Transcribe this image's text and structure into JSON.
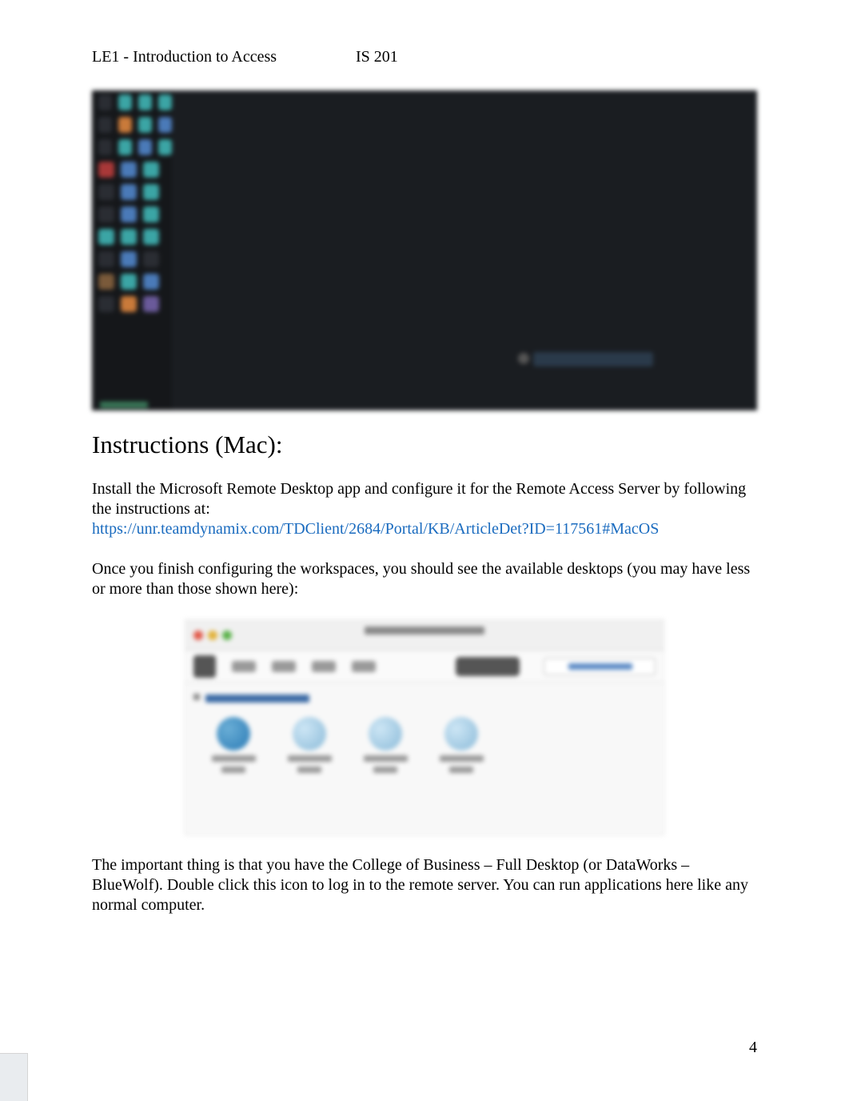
{
  "header": {
    "title_left": "LE1 - Introduction to Access",
    "title_right": "IS 201"
  },
  "section_heading": "Instructions (Mac):",
  "para1_pre": "Install the Microsoft Remote Desktop app and configure it for the Remote Access Server by following the instructions at:",
  "link1": "https://unr.teamdynamix.com/TDClient/2684/Portal/KB/ArticleDet?ID=117561#MacOS",
  "para2": "Once you finish configuring the workspaces, you should see the available desktops (you may have less or more than those shown here):",
  "para3": "The important thing is that you have the College of Business – Full Desktop (or DataWorks – BlueWolf). Double click this icon to log in to the remote server. You can run applications here like any normal computer.",
  "page_number": "4"
}
